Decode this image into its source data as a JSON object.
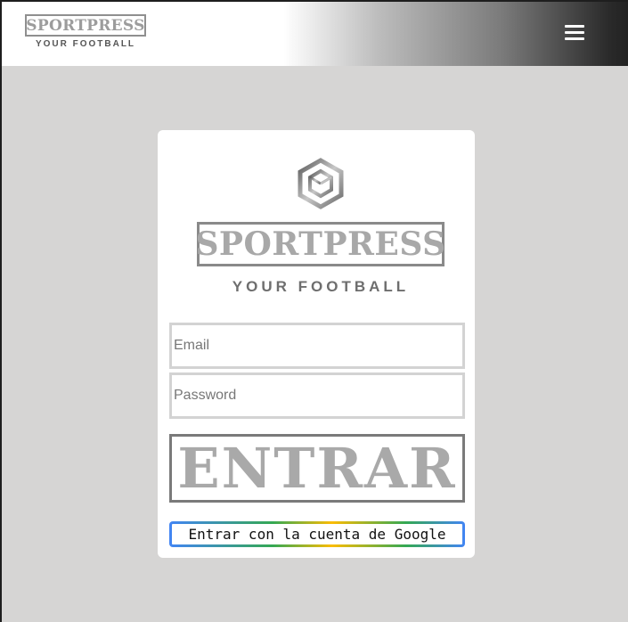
{
  "header": {
    "brand_name": "SPORTPRESS",
    "brand_tagline": "YOUR FOOTBALL",
    "menu_icon": "hamburger-menu-icon"
  },
  "login": {
    "logo_icon": "hexagon-cube-logo-icon",
    "logo_name": "SPORTPRESS",
    "logo_tagline": "YOUR FOOTBALL",
    "email_placeholder": "Email",
    "email_value": "",
    "password_placeholder": "Password",
    "password_value": "",
    "submit_label": "ENTRAR",
    "google_label": "Entrar con la cuenta de Google"
  },
  "colors": {
    "page_background": "#d6d5d4",
    "card_background": "#ffffff",
    "logo_gray": "#a8a8a8",
    "google_blue": "#4285f4",
    "google_green": "#34a853",
    "google_yellow": "#fbbc05"
  }
}
